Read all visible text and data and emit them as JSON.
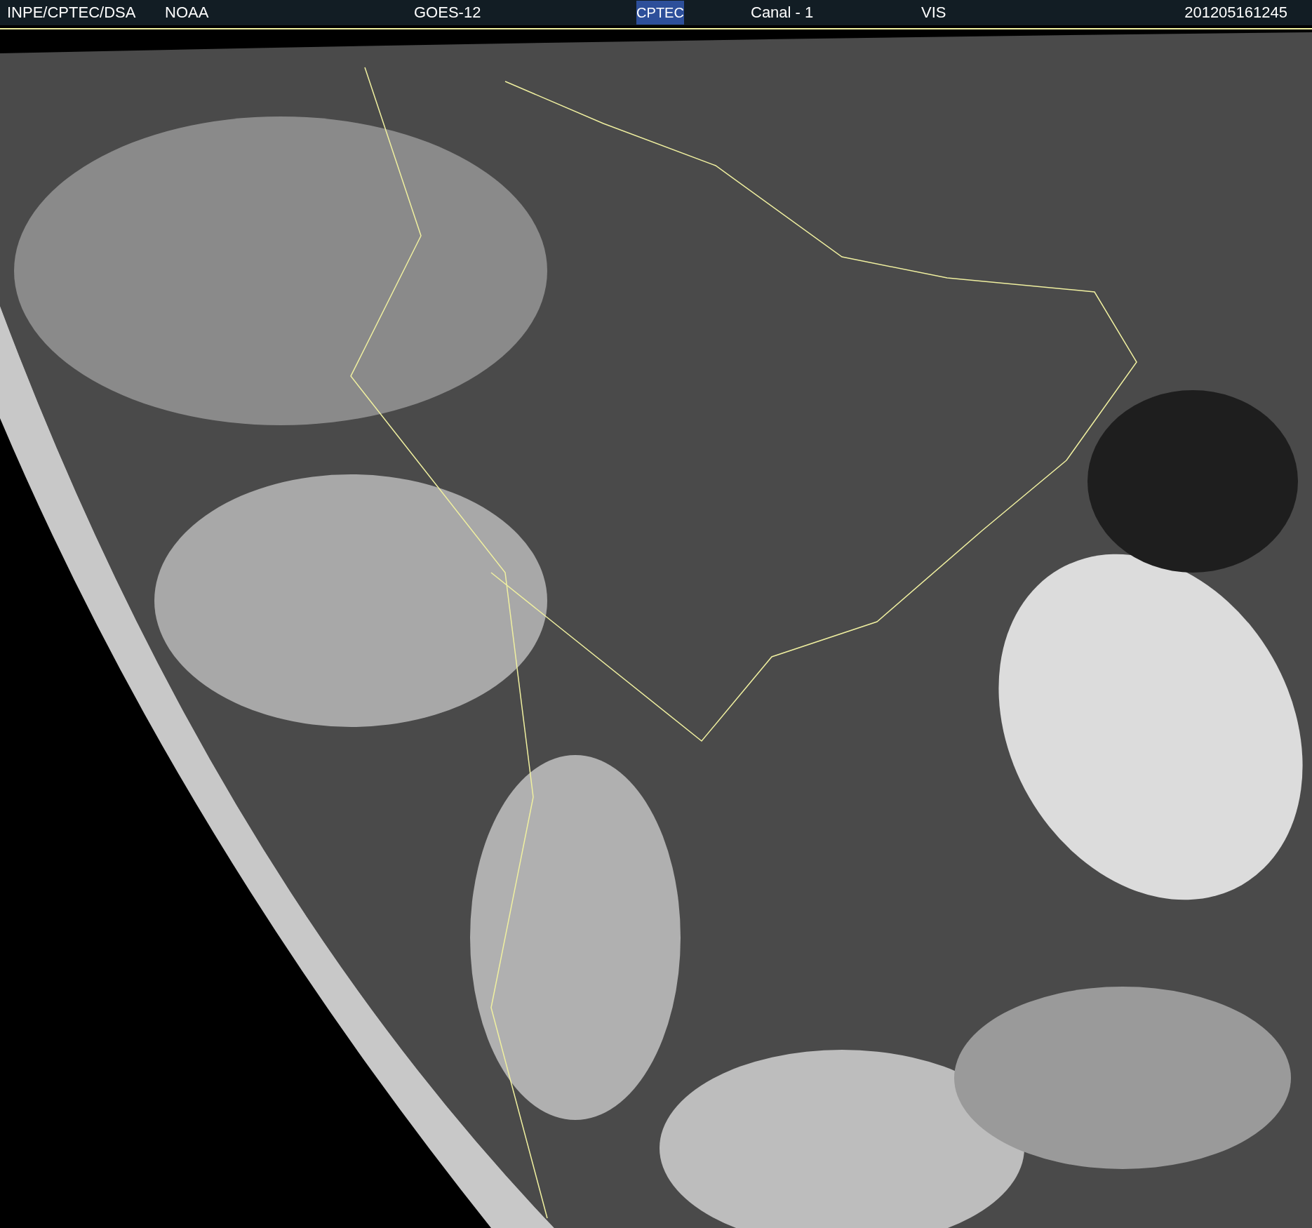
{
  "header": {
    "labels": [
      "INPE/CPTEC/DSA",
      "NOAA",
      "GOES-12"
    ],
    "logo": "CPTEC",
    "channel": "Canal - 1",
    "band": "VIS",
    "timestamp": "201205161245"
  }
}
